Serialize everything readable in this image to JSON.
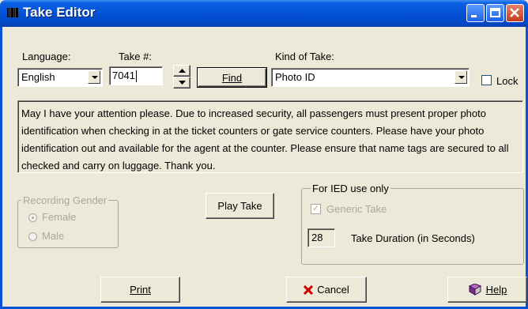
{
  "window": {
    "title": "Take Editor",
    "icon": "barcode-icon"
  },
  "form": {
    "language_label": "Language:",
    "language_value": "English",
    "take_label": "Take #:",
    "take_value": "7041",
    "find_label": "Find",
    "kind_label": "Kind of Take:",
    "kind_value": "Photo ID",
    "lock_label": "Lock",
    "message": "May I have your attention please. Due to increased security, all passengers must present proper photo identification when checking in at the ticket counters or gate service counters. Please have your photo identification out and available for the agent at the counter. Please ensure that name tags are secured to all checked and carry on luggage. Thank you."
  },
  "recording_gender": {
    "title": "Recording Gender",
    "options": [
      "Female",
      "Male"
    ],
    "selected": "Female"
  },
  "play_take_label": "Play Take",
  "ied": {
    "title": "For IED use only",
    "generic_take_label": "Generic Take",
    "generic_take_checked": true,
    "duration_value": "28",
    "duration_label": "Take Duration (in Seconds)"
  },
  "footer": {
    "print_label": "Print",
    "cancel_label": "Cancel",
    "help_label": "Help",
    "colors": {
      "cancel_x": "#cc0000",
      "help_book": "#7a2b8c"
    }
  }
}
